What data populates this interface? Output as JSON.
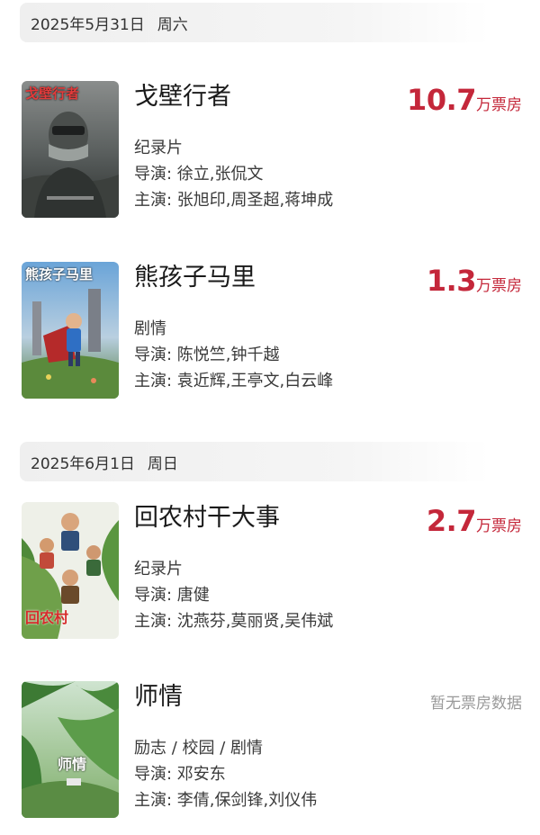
{
  "sections": [
    {
      "date": "2025年5月31日",
      "weekday": "周六",
      "movies": [
        {
          "title": "戈壁行者",
          "poster_text": "戈壁行者",
          "box_value": "10.7",
          "box_unit": "万票房",
          "genre": "纪录片",
          "director": "导演: 徐立,张侃文",
          "cast": "主演: 张旭印,周圣超,蒋坤成"
        },
        {
          "title": "熊孩子马里",
          "poster_text": "熊孩子马里",
          "box_value": "1.3",
          "box_unit": "万票房",
          "genre": "剧情",
          "director": "导演: 陈悦竺,钟千越",
          "cast": "主演: 袁近辉,王亭文,白云峰"
        }
      ]
    },
    {
      "date": "2025年6月1日",
      "weekday": "周日",
      "movies": [
        {
          "title": "回农村干大事",
          "poster_text": "回农村",
          "box_value": "2.7",
          "box_unit": "万票房",
          "genre": "纪录片",
          "director": "导演: 唐健",
          "cast": "主演: 沈燕芬,莫丽贤,吴伟斌"
        },
        {
          "title": "师情",
          "poster_text": "师情",
          "no_box_text": "暂无票房数据",
          "genre": "励志 / 校园 / 剧情",
          "director": "导演: 邓安东",
          "cast": "主演: 李倩,保剑锋,刘仪伟"
        }
      ]
    }
  ],
  "colors": {
    "box_office": "#c4273a",
    "no_box": "#999999",
    "date_bar": "#efefef"
  }
}
